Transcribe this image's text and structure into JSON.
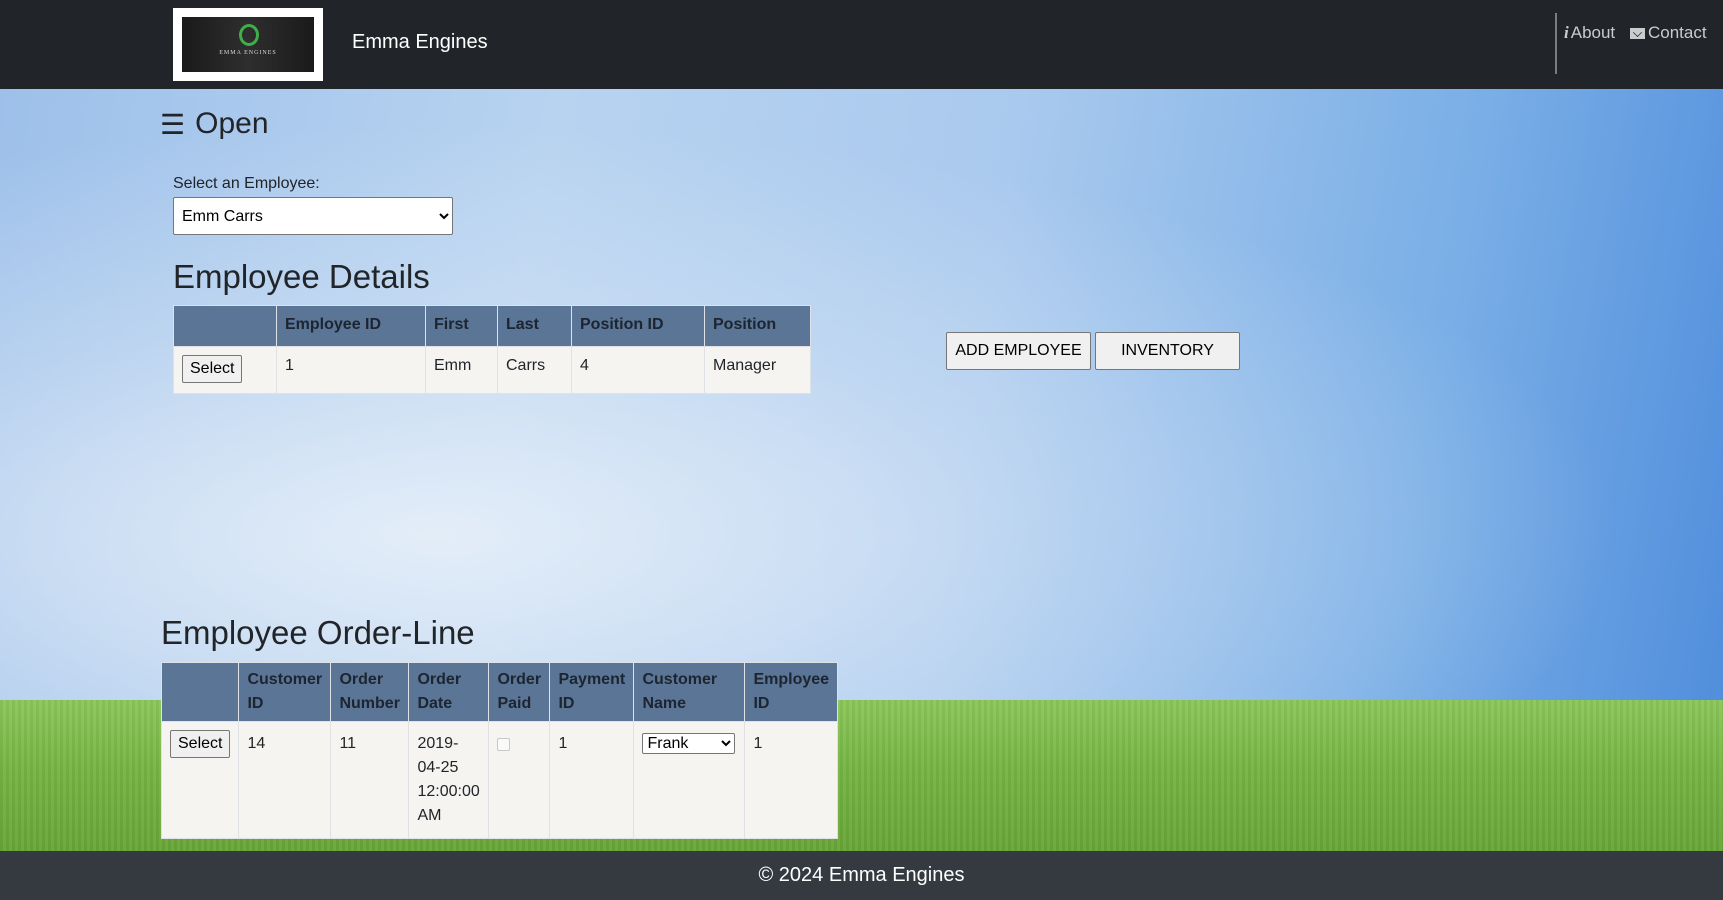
{
  "header": {
    "logo_text": "EMMA ENGINES",
    "brand": "Emma Engines",
    "nav": {
      "about_label": "About",
      "contact_label": "Contact"
    }
  },
  "sidebar_toggle": {
    "icon": "☰",
    "label": "Open"
  },
  "employee_selector": {
    "label": "Select an Employee:",
    "selected": "Emm Carrs"
  },
  "employee_details": {
    "title": "Employee Details",
    "columns": [
      "",
      "Employee ID",
      "First",
      "Last",
      "Position ID",
      "Position"
    ],
    "rows": [
      {
        "button": "Select",
        "employee_id": "1",
        "first": "Emm",
        "last": "Carrs",
        "position_id": "4",
        "position": "Manager"
      }
    ]
  },
  "actions": {
    "add_employee": "ADD EMPLOYEE",
    "inventory": "INVENTORY"
  },
  "order_line": {
    "title": "Employee Order-Line",
    "columns": [
      "",
      "Customer ID",
      "Order Number",
      "Order Date",
      "Order Paid",
      "Payment ID",
      "Customer Name",
      "Employee ID"
    ],
    "rows": [
      {
        "button": "Select",
        "customer_id": "14",
        "order_number": "11",
        "order_date": "2019-04-25 12:00:00 AM",
        "order_paid": false,
        "payment_id": "1",
        "customer_name": "Frank",
        "employee_id": "1"
      }
    ]
  },
  "footer": {
    "text": "© 2024 Emma Engines"
  },
  "colors": {
    "header_bg": "#212529",
    "footer_bg": "#343a40",
    "table_header_bg": "#5a7595",
    "table_cell_bg": "#f5f4f1"
  }
}
